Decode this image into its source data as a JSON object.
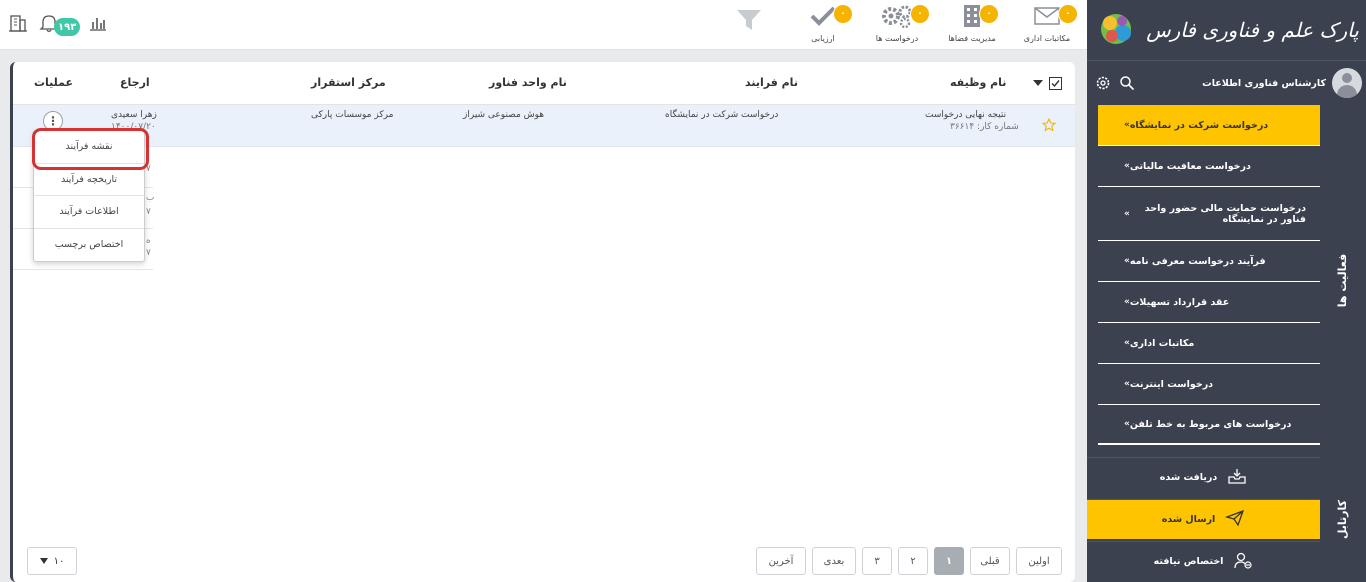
{
  "topbar": {
    "items": [
      {
        "label": "مکاتبات اداری",
        "badge": "۰",
        "icon": "envelope-icon"
      },
      {
        "label": "مدیریت فضاها",
        "badge": "۰",
        "icon": "building-icon"
      },
      {
        "label": "درخواست ها",
        "badge": "۰",
        "icon": "gears-icon"
      },
      {
        "label": "ارزیابی",
        "badge": "۰",
        "icon": "checkmark-icon"
      }
    ],
    "filter_icon": "filter-icon",
    "notification_count": "۱۹۳",
    "left_icons": [
      "chart-icon",
      "bell-icon",
      "building-outline-icon"
    ]
  },
  "table": {
    "columns": {
      "task_name": "نام وظیفه",
      "process_name": "نام فرایند",
      "tech_unit": "نام واحد فناور",
      "location": "مرکز استقرار",
      "assignee": "ارجاع",
      "actions": "عملیات"
    },
    "rows": [
      {
        "task_name": "نتیجه نهایی درخواست",
        "task_number": "شماره کار: ۳۶۶۱۴",
        "process_name": "درخواست شرکت در نمایشگاه",
        "tech_unit": "هوش مصنوعی شیراز",
        "location": "مرکز موسسات پارکی",
        "assignee": "زهرا سعیدی",
        "assignee_date": "۱۴۰۰/۰۷/۲۰"
      }
    ],
    "ghost_chars": [
      "۷",
      "ب",
      "۷",
      "ه",
      "۷"
    ]
  },
  "context_menu": {
    "items": [
      "نقشه فرآیند",
      "تاریخچه فرآیند",
      "اطلاعات فرآیند",
      "اختصاص برچسب"
    ]
  },
  "pagination": {
    "first": "اولین",
    "prev": "قبلی",
    "pages": [
      "۱",
      "۲",
      "۳"
    ],
    "current": "۱",
    "next": "بعدی",
    "last": "آخرین",
    "page_size": "۱۰"
  },
  "sidebar": {
    "logo_text": "پارک علم و فناوری فارس",
    "user_name": "کارشناس فناوری اطلاعات",
    "activities_tab": "فعالیت ها",
    "activities": [
      "درخواست شرکت در نمایشگاه",
      "درخواست معافیت مالیاتی",
      "درخواست حمایت مالی حضور واحد فناور در نمایشگاه",
      "فرآیند درخواست معرفی نامه",
      "عقد قرارداد تسهیلات",
      "مکاتبات اداری",
      "درخواست اینترنت",
      "درخواست های مربوط به خط تلفن"
    ],
    "cartable_tab": "کارتابل",
    "cartable": [
      {
        "label": "دریافت شده",
        "icon": "inbox-icon"
      },
      {
        "label": "ارسال شده",
        "icon": "send-icon"
      },
      {
        "label": "اختصاص نیافته",
        "icon": "unassigned-user-icon"
      }
    ]
  },
  "colors": {
    "accent": "#ffc400",
    "sidebar_bg": "#3c4150",
    "badge": "#f4b400",
    "notification": "#3fc7a8",
    "highlight_ring": "#d63232"
  }
}
